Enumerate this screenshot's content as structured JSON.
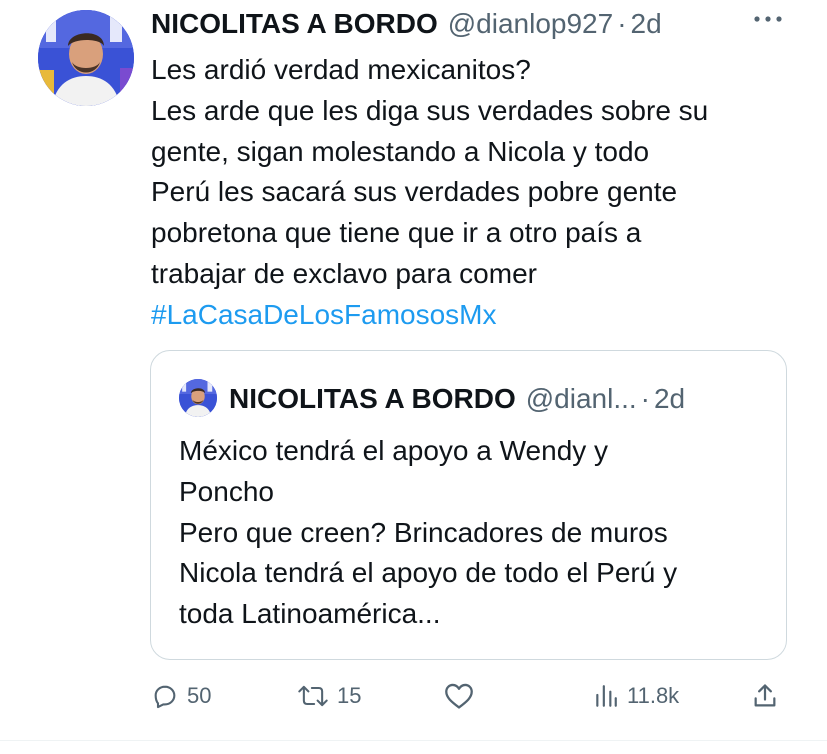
{
  "tweet": {
    "author": {
      "display_name": "NICOLITAS A BORDO",
      "handle": "@dianlop927",
      "dot": "·",
      "time": "2d"
    },
    "more_icon": "more-horizontal-icon",
    "text_lines": [
      "Les ardió verdad mexicanitos?",
      "Les arde que les diga sus verdades sobre su",
      "gente, sigan molestando a Nicola y todo",
      "Perú les sacará sus verdades pobre gente",
      "pobretona que tiene que ir a otro país a",
      "trabajar de exclavo para comer"
    ],
    "hashtag": "#LaCasaDeLosFamososMx",
    "quote": {
      "display_name": "NICOLITAS A BORDO",
      "handle": "@dianl...",
      "dot": "·",
      "time": "2d",
      "text_lines": [
        "México tendrá el apoyo a Wendy y",
        "Poncho",
        "Pero que creen? Brincadores de muros",
        "Nicola tendrá el apoyo de todo el Perú y",
        "toda Latinoamérica..."
      ]
    },
    "actions": {
      "reply": {
        "icon": "reply-icon",
        "count": "50"
      },
      "retweet": {
        "icon": "retweet-icon",
        "count": "15"
      },
      "like": {
        "icon": "heart-icon",
        "count": ""
      },
      "views": {
        "icon": "views-icon",
        "count": "11.8k"
      },
      "share": {
        "icon": "share-icon"
      }
    }
  },
  "colors": {
    "text": "#0f1419",
    "secondary": "#536471",
    "link": "#1d9bf0",
    "border": "#cfd9de"
  }
}
